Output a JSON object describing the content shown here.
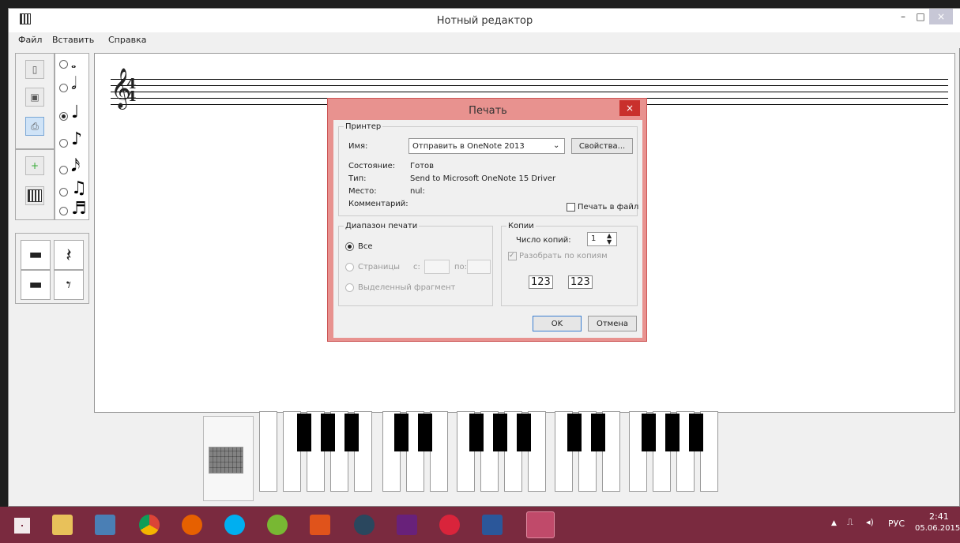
{
  "app": {
    "title": "Нотный редактор",
    "min": "–",
    "max": "□",
    "close": "×"
  },
  "menu": [
    "Файл",
    "Вставить",
    "Справка"
  ],
  "notes": [
    "○",
    "◌"
  ],
  "rest_glyphs": [
    "▬",
    "𝄽",
    "▬",
    "𝄾"
  ],
  "staff": {
    "clef": "𝄞",
    "ts_top": "4",
    "ts_bottom": "4"
  },
  "dialog": {
    "title": "Печать",
    "close": "×",
    "printer": {
      "group": "Принтер",
      "name_label": "Имя:",
      "name_value": "Отправить в OneNote 2013",
      "props_button": "Свойства...",
      "status_label": "Состояние:",
      "status_value": "Готов",
      "type_label": "Тип:",
      "type_value": "Send to Microsoft OneNote 15 Driver",
      "where_label": "Место:",
      "where_value": "nul:",
      "comment_label": "Комментарий:",
      "print_to_file": "Печать в файл"
    },
    "range": {
      "group": "Диапазон печати",
      "all": "Все",
      "pages": "Страницы",
      "from": "с:",
      "to": "по:",
      "selection": "Выделенный фрагмент"
    },
    "copies": {
      "group": "Копии",
      "count_label": "Число копий:",
      "count_value": "1",
      "collate": "Разобрать по копиям",
      "collate_icon": "123"
    },
    "ok": "OK",
    "cancel": "Отмена"
  },
  "taskbar": {
    "lang": "РУС",
    "time": "2:41",
    "date": "05.06.2015",
    "icons": [
      "windows-start",
      "explorer",
      "network",
      "chrome",
      "firefox",
      "skype",
      "utorrent",
      "app-orange",
      "steam",
      "visual-studio",
      "media",
      "word",
      "piano-app"
    ]
  },
  "colors": {
    "accent": "#e8928f",
    "taskbar": "#7a2a3f"
  }
}
